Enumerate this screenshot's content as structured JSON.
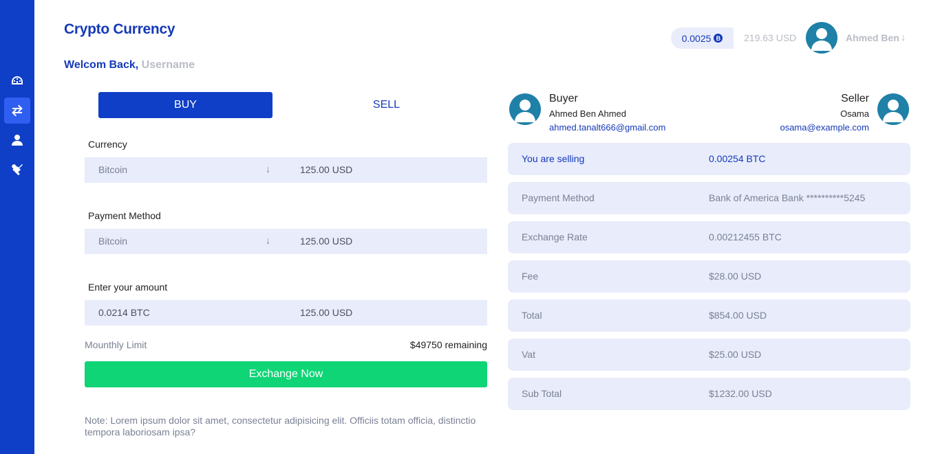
{
  "header": {
    "title": "Crypto Currency",
    "welcome": "Welcom Back,",
    "username": "Username",
    "btc_balance": "0.0025",
    "btc_symbol": "B",
    "usd_balance": "219.63 USD",
    "user_name": "Ahmed Ben",
    "user_arrow": "↓"
  },
  "sidebar": {
    "items": [
      {
        "icon": "dashboard-icon",
        "active": false
      },
      {
        "icon": "exchange-icon",
        "active": true
      },
      {
        "icon": "user-icon",
        "active": false
      },
      {
        "icon": "tools-icon",
        "active": false
      }
    ]
  },
  "tabs": {
    "buy": "BUY",
    "sell": "SELL"
  },
  "form": {
    "currency": {
      "label": "Currency",
      "value": "Bitcoin",
      "arrow": "↓",
      "usd": "125.00 USD"
    },
    "payment_method": {
      "label": "Payment Method",
      "value": "Bitcoin",
      "arrow": "↓",
      "usd": "125.00 USD"
    },
    "amount": {
      "label": "Enter your amount",
      "value": "0.0214 BTC",
      "usd": "125.00 USD"
    },
    "limit_label": "Mounthly Limit",
    "limit_value": "$49750 remaining",
    "exchange_button": "Exchange Now",
    "note": "Note: Lorem ipsum dolor sit amet, consectetur adipisicing elit. Officiis totam officia, distinctio tempora laboriosam ipsa?"
  },
  "buyer": {
    "title": "Buyer",
    "name": "Ahmed Ben Ahmed",
    "email": "ahmed.tanalt666@gmail.com"
  },
  "seller": {
    "title": "Seller",
    "name": "Osama",
    "email": "osama@example.com"
  },
  "details": [
    {
      "label": "You are selling",
      "value": "0.00254 BTC"
    },
    {
      "label": "Payment Method",
      "value": "Bank of America Bank **********5245"
    },
    {
      "label": "Exchange Rate",
      "value": "0.00212455 BTC"
    },
    {
      "label": "Fee",
      "value": "$28.00 USD"
    },
    {
      "label": "Total",
      "value": "$854.00 USD"
    },
    {
      "label": "Vat",
      "value": "$25.00 USD"
    },
    {
      "label": "Sub Total",
      "value": "$1232.00 USD"
    }
  ],
  "colors": {
    "sidebar": "#0f3ec7",
    "primary": "#1539b8",
    "success": "#0fd576",
    "field_bg": "#e8ecfb",
    "avatar": "#1f80a8"
  }
}
